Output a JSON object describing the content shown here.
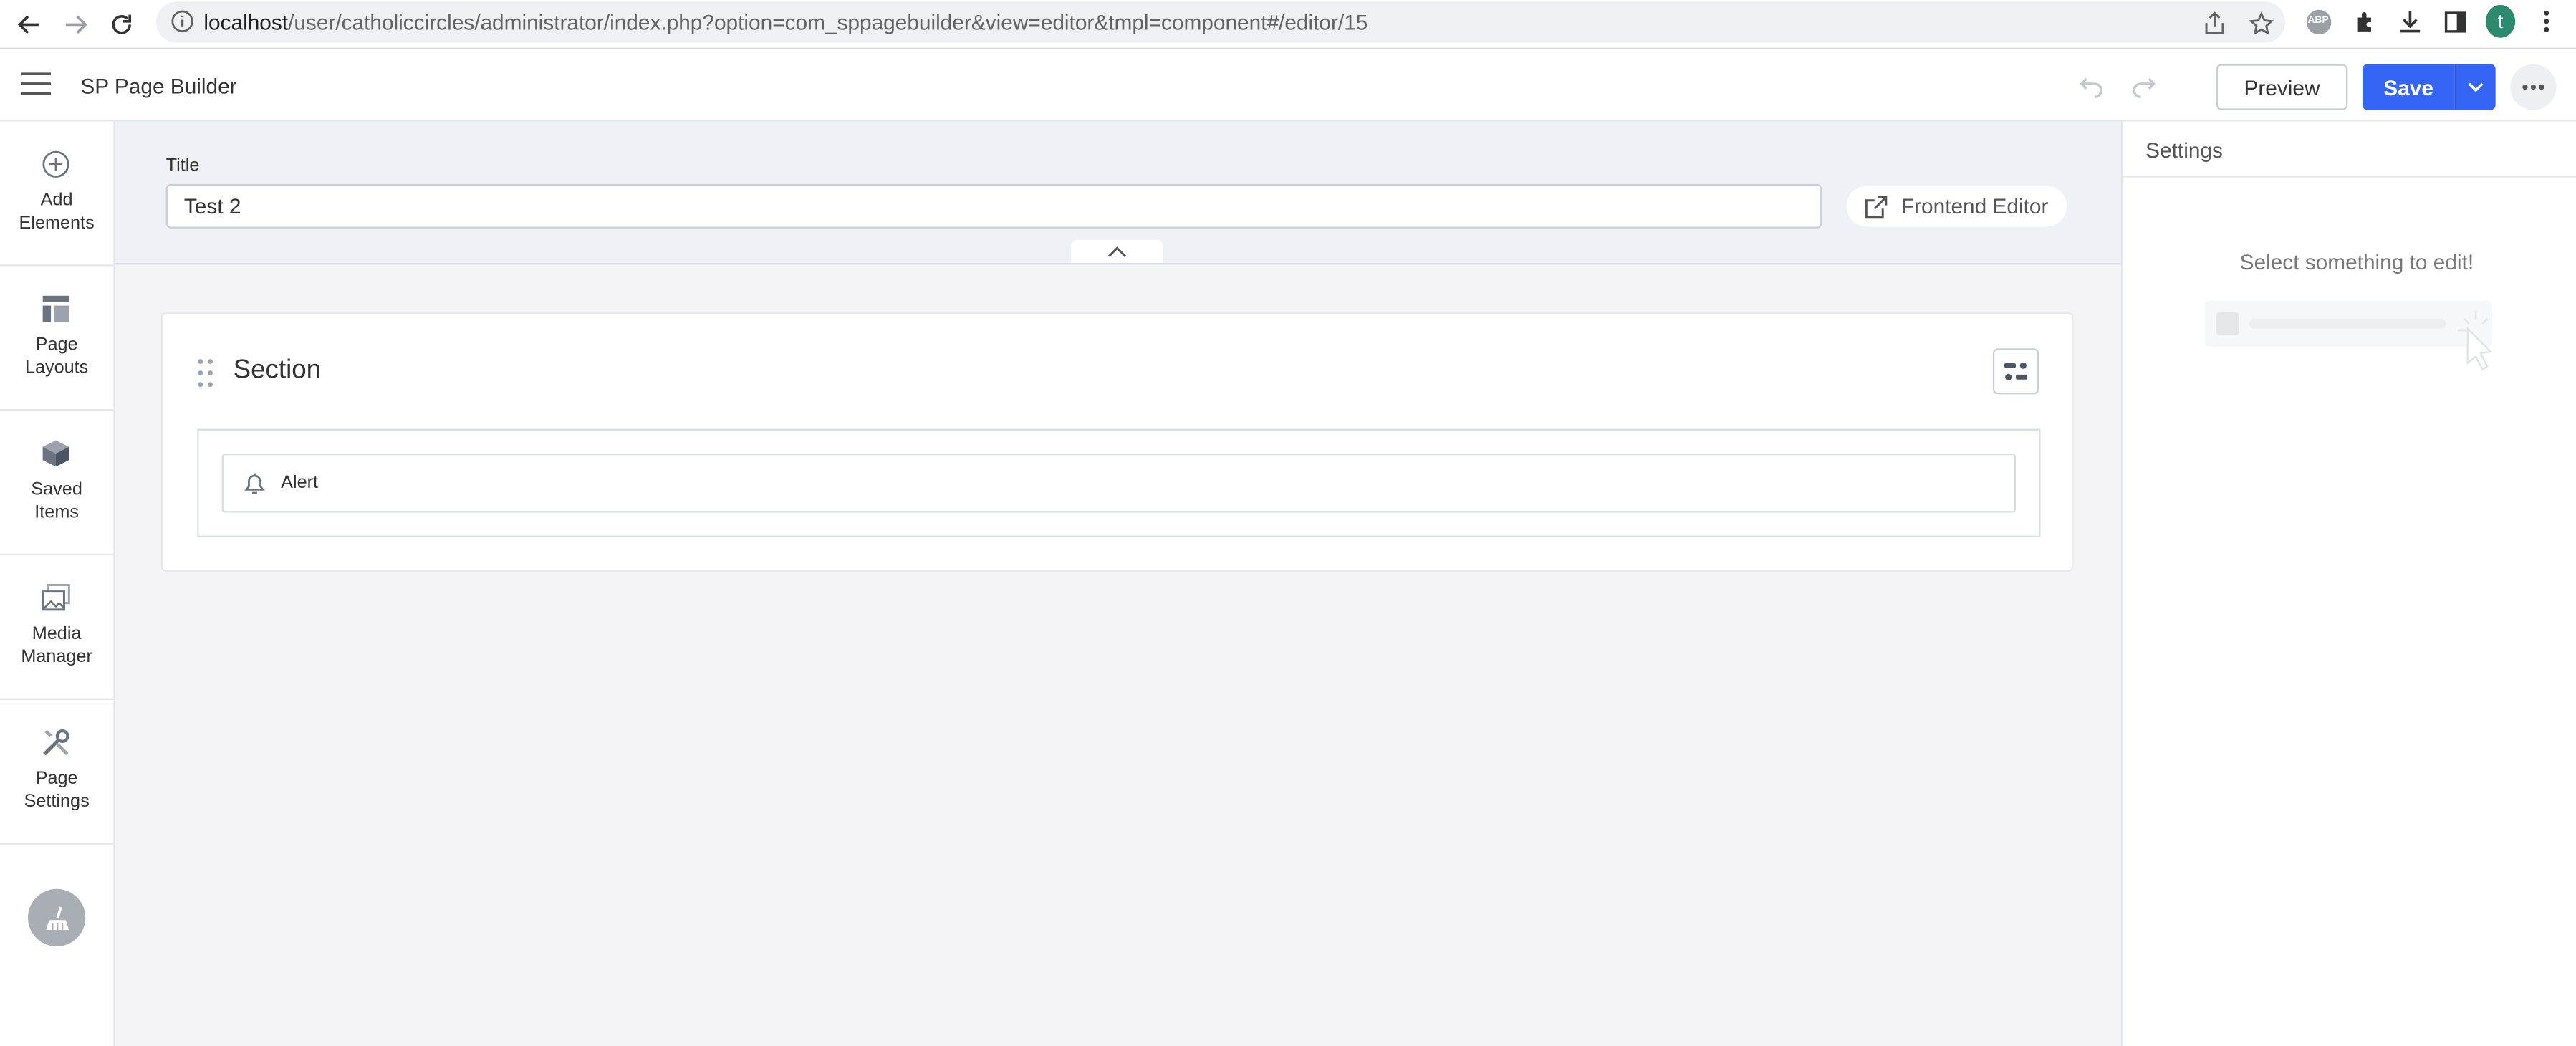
{
  "browser": {
    "url_host": "localhost",
    "url_path": "/user/catholiccircles/administrator/index.php?option=com_sppagebuilder&view=editor&tmpl=component#/editor/15",
    "profile_initial": "t",
    "extension_abp": "ABP",
    "icons": [
      "back-icon",
      "forward-icon",
      "reload-icon",
      "info-icon",
      "share-icon",
      "star-icon",
      "puzzle-icon",
      "download-icon",
      "sidepanel-icon",
      "kebab-icon"
    ]
  },
  "header": {
    "app_title": "SP Page Builder",
    "preview_label": "Preview",
    "save_label": "Save"
  },
  "sidebar": {
    "items": [
      {
        "label": "Add\nElements",
        "icon": "plus-circle-icon"
      },
      {
        "label": "Page\nLayouts",
        "icon": "layout-icon"
      },
      {
        "label": "Saved\nItems",
        "icon": "box-icon"
      },
      {
        "label": "Media\nManager",
        "icon": "images-icon"
      },
      {
        "label": "Page\nSettings",
        "icon": "tools-icon"
      }
    ],
    "bottom_icon": "broom-icon"
  },
  "editor": {
    "title_label": "Title",
    "title_value": "Test 2",
    "frontend_editor_label": "Frontend Editor",
    "section_title": "Section",
    "addon_name": "Alert"
  },
  "settings": {
    "title": "Settings",
    "empty_message": "Select something to edit!"
  },
  "colors": {
    "accent": "#3565f4",
    "main_bg": "#f4f4f6",
    "title_panel_bg": "#eef1f6",
    "avatar": "#2e8a6e"
  }
}
